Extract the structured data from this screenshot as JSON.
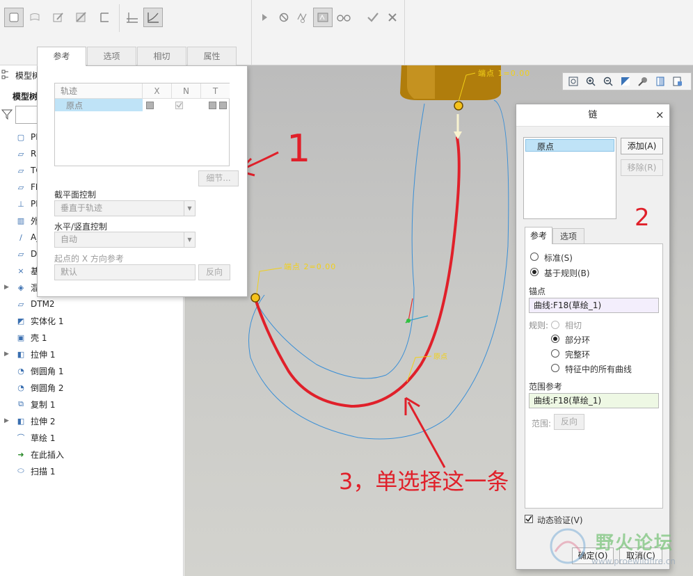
{
  "ribbon": {
    "tabs": [
      {
        "label": "参考",
        "active": true
      },
      {
        "label": "选项",
        "active": false
      },
      {
        "label": "相切",
        "active": false
      },
      {
        "label": "属性",
        "active": false
      }
    ]
  },
  "tree": {
    "header_title": "模型树",
    "subheader": "模型树",
    "items": [
      {
        "label": "PIPE-",
        "icon": "part-icon"
      },
      {
        "label": "RI",
        "icon": "datum-plane-icon"
      },
      {
        "label": "TO",
        "icon": "datum-plane-icon"
      },
      {
        "label": "FR",
        "icon": "datum-plane-icon"
      },
      {
        "label": "PI",
        "icon": "coordinate-system-icon"
      },
      {
        "label": "外",
        "icon": "appearance-icon"
      },
      {
        "label": "A_",
        "icon": "axis-icon"
      },
      {
        "label": "DT",
        "icon": "datum-plane-icon"
      },
      {
        "label": "基",
        "icon": "datum-point-icon"
      },
      {
        "label": "混",
        "icon": "blend-icon",
        "expandable": true
      },
      {
        "label": "DTM2",
        "icon": "datum-plane-icon"
      },
      {
        "label": "实体化 1",
        "icon": "solidify-icon"
      },
      {
        "label": "壳 1",
        "icon": "shell-icon"
      },
      {
        "label": "拉伸 1",
        "icon": "extrude-icon",
        "expandable": true
      },
      {
        "label": "倒圆角 1",
        "icon": "round-icon"
      },
      {
        "label": "倒圆角 2",
        "icon": "round-icon"
      },
      {
        "label": "复制 1",
        "icon": "copy-icon"
      },
      {
        "label": "拉伸 2",
        "icon": "extrude-icon",
        "expandable": true
      },
      {
        "label": "草绘 1",
        "icon": "sketch-icon"
      },
      {
        "label": "在此插入",
        "icon": "insert-here-icon"
      },
      {
        "label": "扫描 1",
        "icon": "sweep-icon"
      }
    ]
  },
  "refpanel": {
    "table_headers": [
      "轨迹",
      "X",
      "N",
      "T"
    ],
    "table_row": "原点",
    "details_button": "细节...",
    "section_control_label": "截平面控制",
    "section_control_value": "垂直于轨迹",
    "hv_control_label": "水平/竖直控制",
    "hv_control_value": "自动",
    "x_dir_label": "起点的 X 方向参考",
    "x_dir_value": "默认",
    "flip_button": "反向"
  },
  "viewport": {
    "label_start": "端点 1=0.00",
    "label_end": "端点 2=0.00",
    "label_mid": "原点"
  },
  "chain": {
    "title": "链",
    "close": "×",
    "list_item": "原点",
    "add_button": "添加(A)",
    "remove_button": "移除(R)",
    "tab_ref": "参考",
    "tab_options": "选项",
    "radio_standard": "标准(S)",
    "radio_rule": "基于规则(B)",
    "anchor_label": "锚点",
    "anchor_value": "曲线:F18(草绘_1)",
    "rule_label": "规则:",
    "rule_tangent": "相切",
    "rule_partial": "部分环",
    "rule_complete": "完整环",
    "rule_all": "特征中的所有曲线",
    "range_ref_label": "范围参考",
    "range_ref_value": "曲线:F18(草绘_1)",
    "range_label": "范围:",
    "range_flip": "反向",
    "dynamic_verify": "动态验证(V)",
    "ok_button": "确定(O)",
    "cancel_button": "取消(C)"
  },
  "annotations": {
    "num1": "1",
    "num2": "2",
    "step3": "3，单选择这一条"
  },
  "watermark": {
    "name": "野火论坛",
    "url": "www.proewildfire.cn"
  },
  "colors": {
    "annotation_red": "#e0202a",
    "curve_blue": "#3a8fd6",
    "selection_highlight": "#bfe3f7",
    "model_gold": "#b5850f",
    "label_yellow": "#f2d018"
  }
}
